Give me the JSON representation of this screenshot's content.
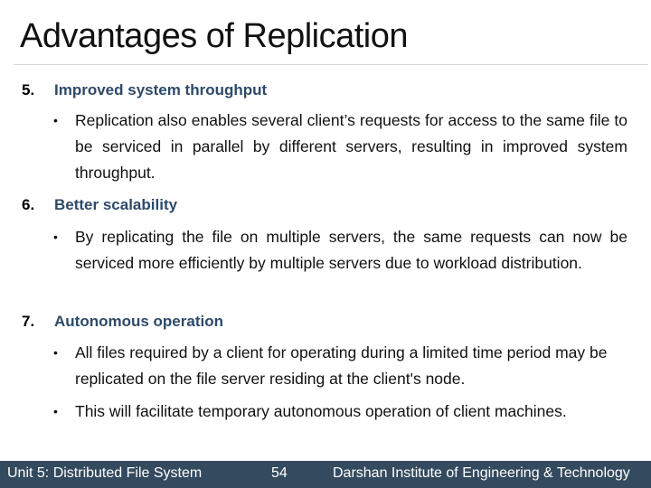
{
  "slide": {
    "title": "Advantages of Replication",
    "sections": [
      {
        "number": "5.",
        "heading": "Improved system throughput",
        "bullets": [
          "Replication also enables several client’s requests for access to the same file to be serviced in parallel by different servers, resulting in improved system throughput."
        ]
      },
      {
        "number": "6.",
        "heading": "Better scalability",
        "bullets": [
          "By replicating the file on multiple servers, the same requests can now be serviced more efficiently by multiple servers due to workload distribution."
        ]
      },
      {
        "number": "7.",
        "heading": "Autonomous operation",
        "bullets": [
          "All files required by a client for operating during a limited time period may be replicated on the file server residing at the client's node.",
          "This will facilitate temporary autonomous operation of client machines."
        ]
      }
    ],
    "bullet_glyph": "•"
  },
  "footer": {
    "unit": "Unit 5: Distributed File System",
    "page_number": "54",
    "institute": "Darshan Institute of Engineering & Technology"
  },
  "colors": {
    "heading": "#2e4a68",
    "footer_bg": "#344a5e"
  }
}
